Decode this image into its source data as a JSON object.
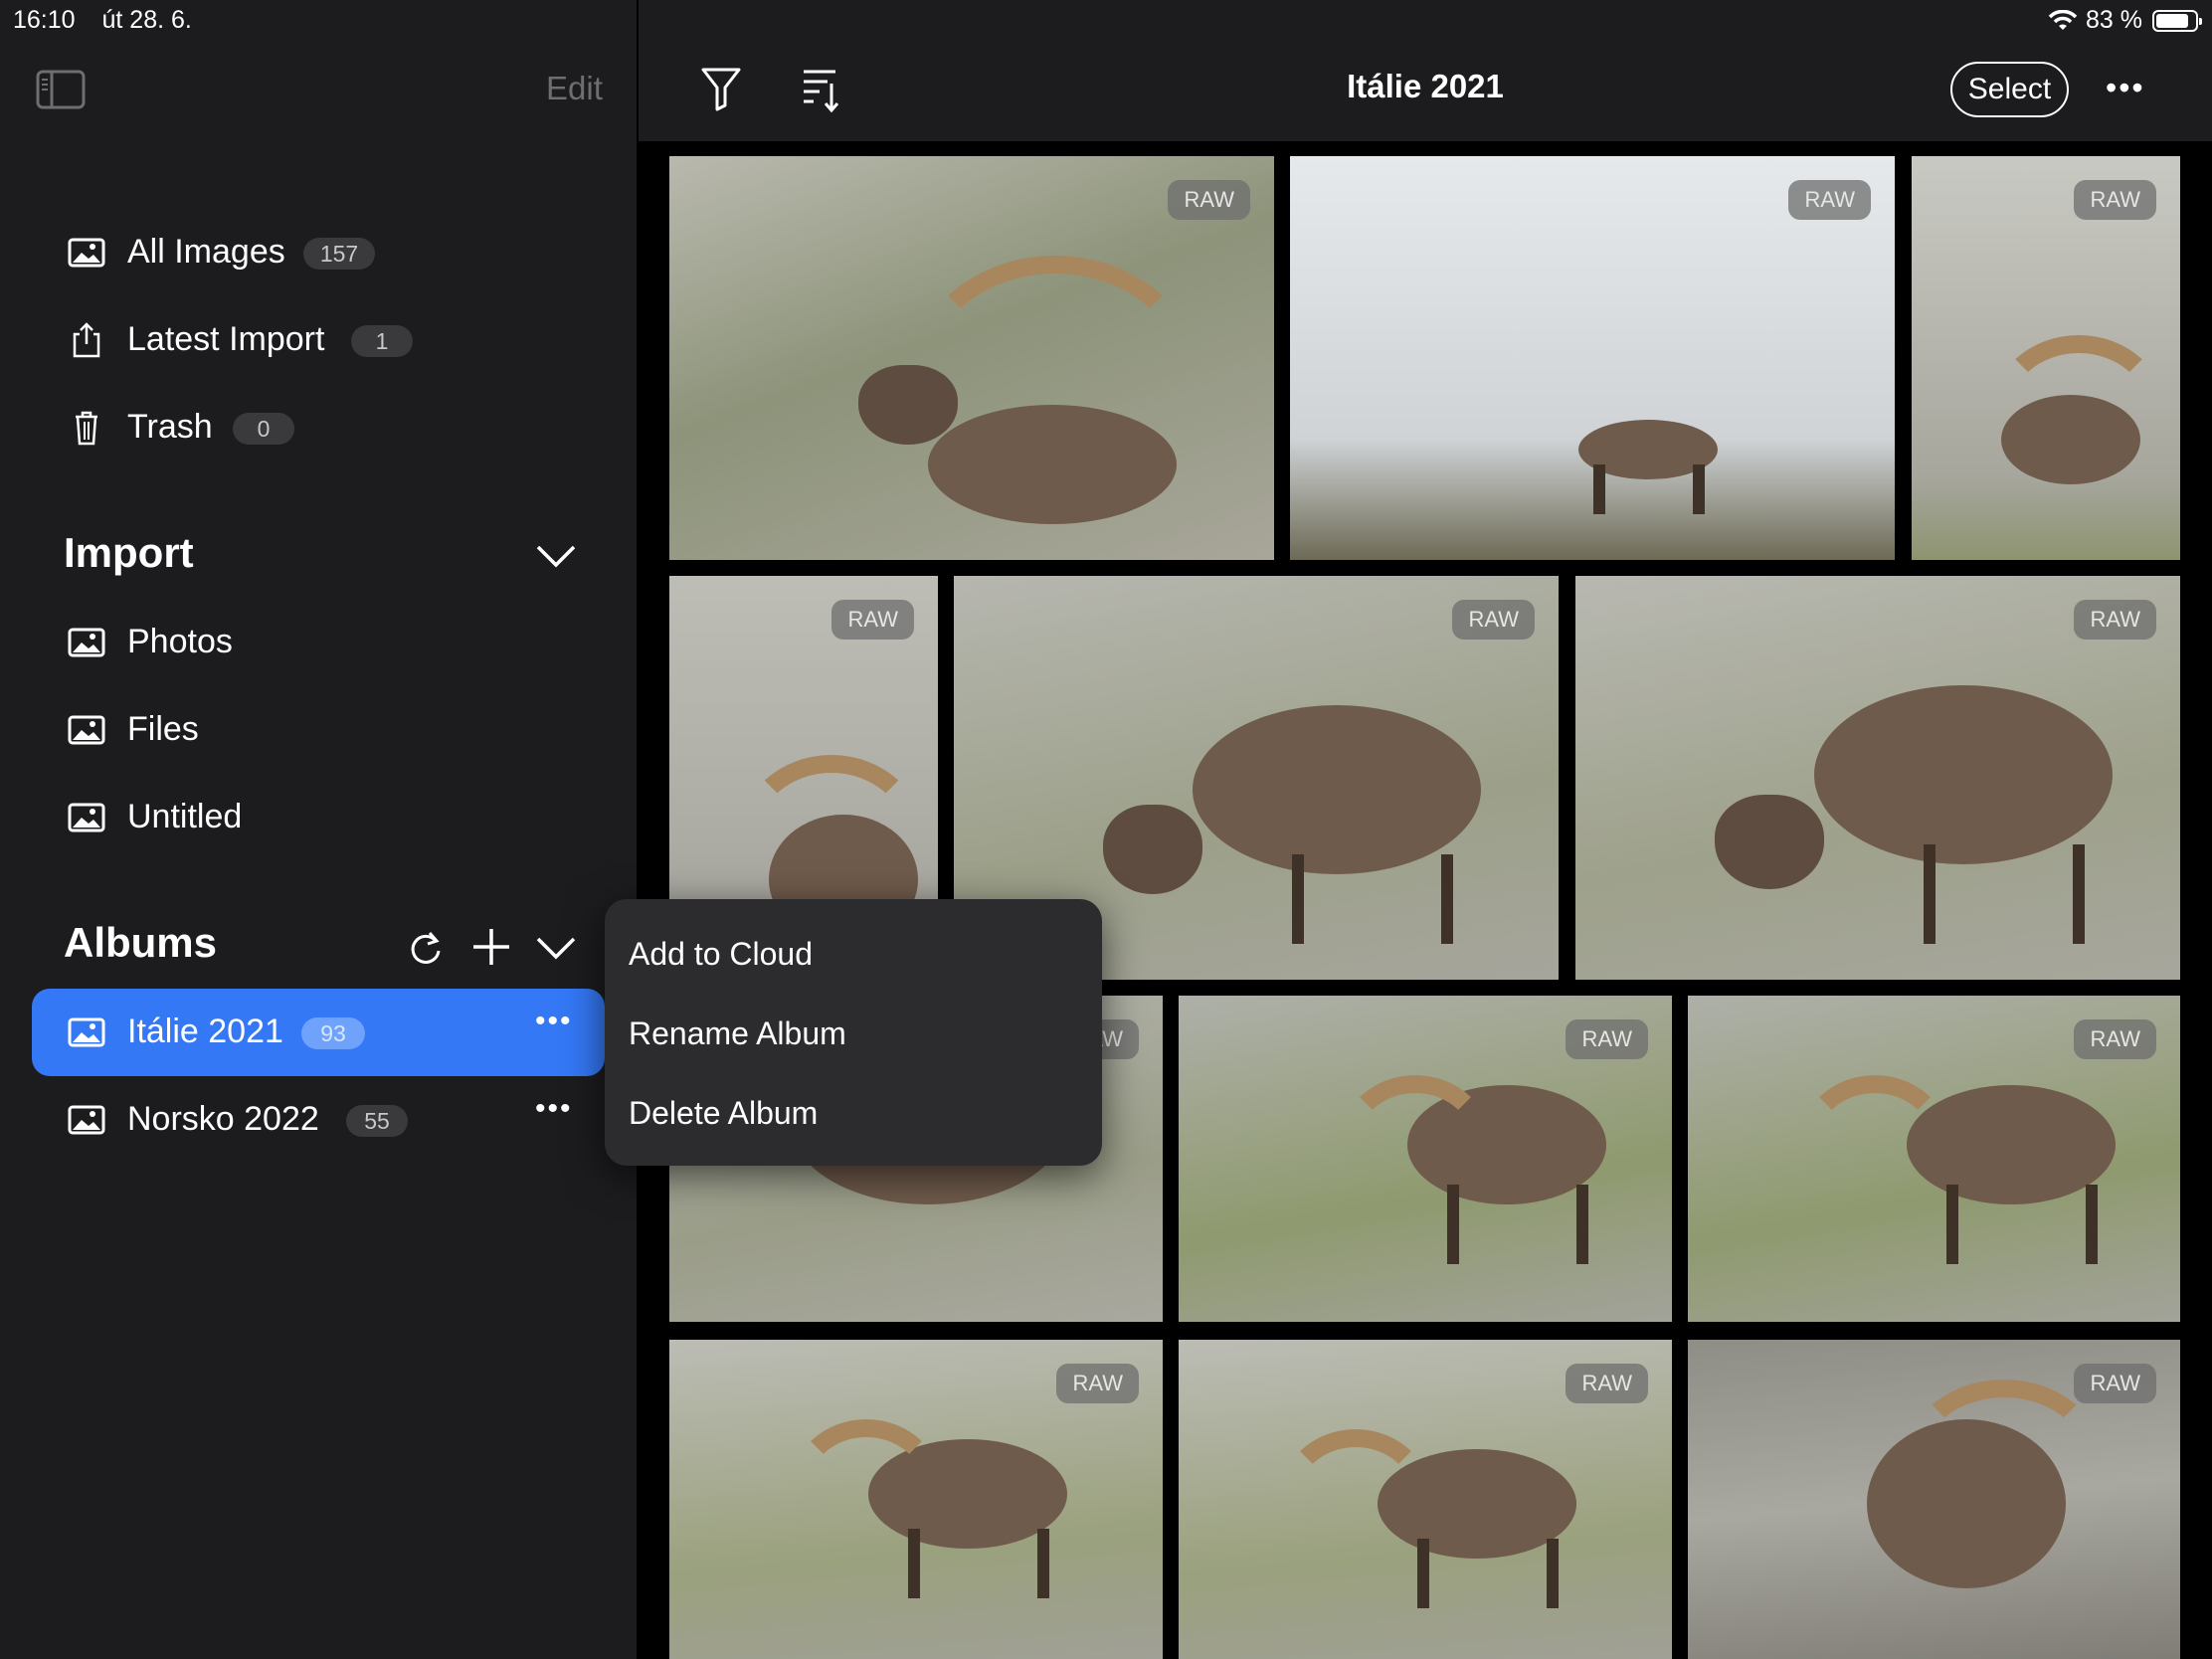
{
  "status_bar": {
    "time": "16:10",
    "date": "út 28. 6.",
    "battery": "83 %",
    "battery_level": 0.83
  },
  "sidebar": {
    "edit_label": "Edit",
    "library": [
      {
        "label": "All Images",
        "count": "157",
        "icon": "photo-icon"
      },
      {
        "label": "Latest Import",
        "count": "1",
        "icon": "share-icon"
      },
      {
        "label": "Trash",
        "count": "0",
        "icon": "trash-icon"
      }
    ],
    "import": {
      "title": "Import",
      "items": [
        {
          "label": "Photos",
          "icon": "photo-icon"
        },
        {
          "label": "Files",
          "icon": "photo-icon"
        },
        {
          "label": "Untitled",
          "icon": "photo-icon"
        }
      ]
    },
    "albums": {
      "title": "Albums",
      "items": [
        {
          "label": "Itálie 2021",
          "count": "93",
          "selected": true
        },
        {
          "label": "Norsko 2022",
          "count": "55",
          "selected": false
        }
      ]
    }
  },
  "toolbar": {
    "title": "Itálie 2021",
    "select_label": "Select"
  },
  "photos": {
    "raw_label": "RAW"
  },
  "context_menu": {
    "items": [
      "Add to Cloud",
      "Rename Album",
      "Delete Album"
    ]
  },
  "colors": {
    "accent": "#3478f6",
    "sidebar_bg": "#1c1c1e",
    "menu_bg": "#2c2c2e"
  }
}
